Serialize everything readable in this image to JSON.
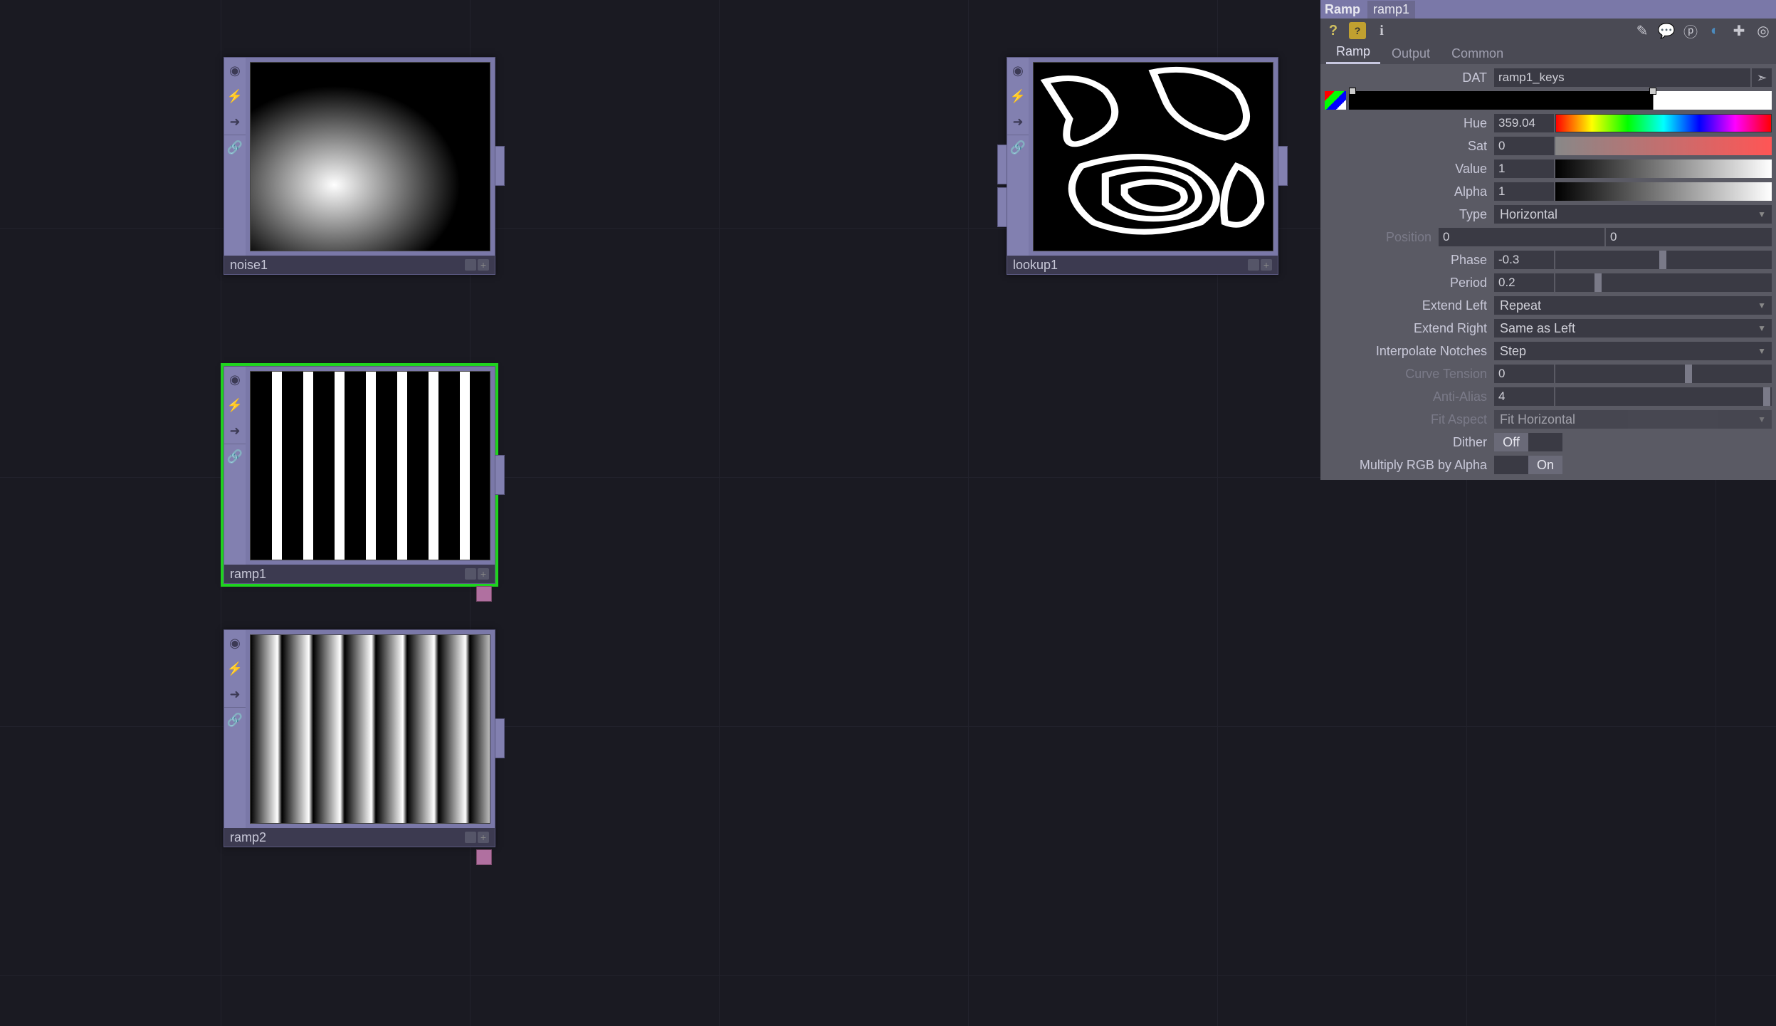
{
  "nodes": {
    "noise1": {
      "name": "noise1"
    },
    "ramp1": {
      "name": "ramp1"
    },
    "ramp2": {
      "name": "ramp2"
    },
    "lookup1": {
      "name": "lookup1"
    }
  },
  "panel": {
    "op_type": "Ramp",
    "op_name": "ramp1",
    "tabs": {
      "ramp": "Ramp",
      "output": "Output",
      "common": "Common"
    },
    "dat": {
      "label": "DAT",
      "value": "ramp1_keys"
    },
    "hue": {
      "label": "Hue",
      "value": "359.04"
    },
    "sat": {
      "label": "Sat",
      "value": "0"
    },
    "value": {
      "label": "Value",
      "value": "1"
    },
    "alpha": {
      "label": "Alpha",
      "value": "1"
    },
    "type": {
      "label": "Type",
      "value": "Horizontal"
    },
    "position": {
      "label": "Position",
      "value0": "0",
      "value1": "0"
    },
    "phase": {
      "label": "Phase",
      "value": "-0.3"
    },
    "period": {
      "label": "Period",
      "value": "0.2"
    },
    "extend_left": {
      "label": "Extend Left",
      "value": "Repeat"
    },
    "extend_right": {
      "label": "Extend Right",
      "value": "Same as Left"
    },
    "interp_notches": {
      "label": "Interpolate Notches",
      "value": "Step"
    },
    "curve_tension": {
      "label": "Curve Tension",
      "value": "0"
    },
    "anti_alias": {
      "label": "Anti-Alias",
      "value": "4"
    },
    "fit_aspect": {
      "label": "Fit Aspect",
      "value": "Fit Horizontal"
    },
    "dither": {
      "label": "Dither",
      "value": "Off"
    },
    "mult_rgb": {
      "label": "Multiply RGB by Alpha",
      "value": "On"
    }
  }
}
